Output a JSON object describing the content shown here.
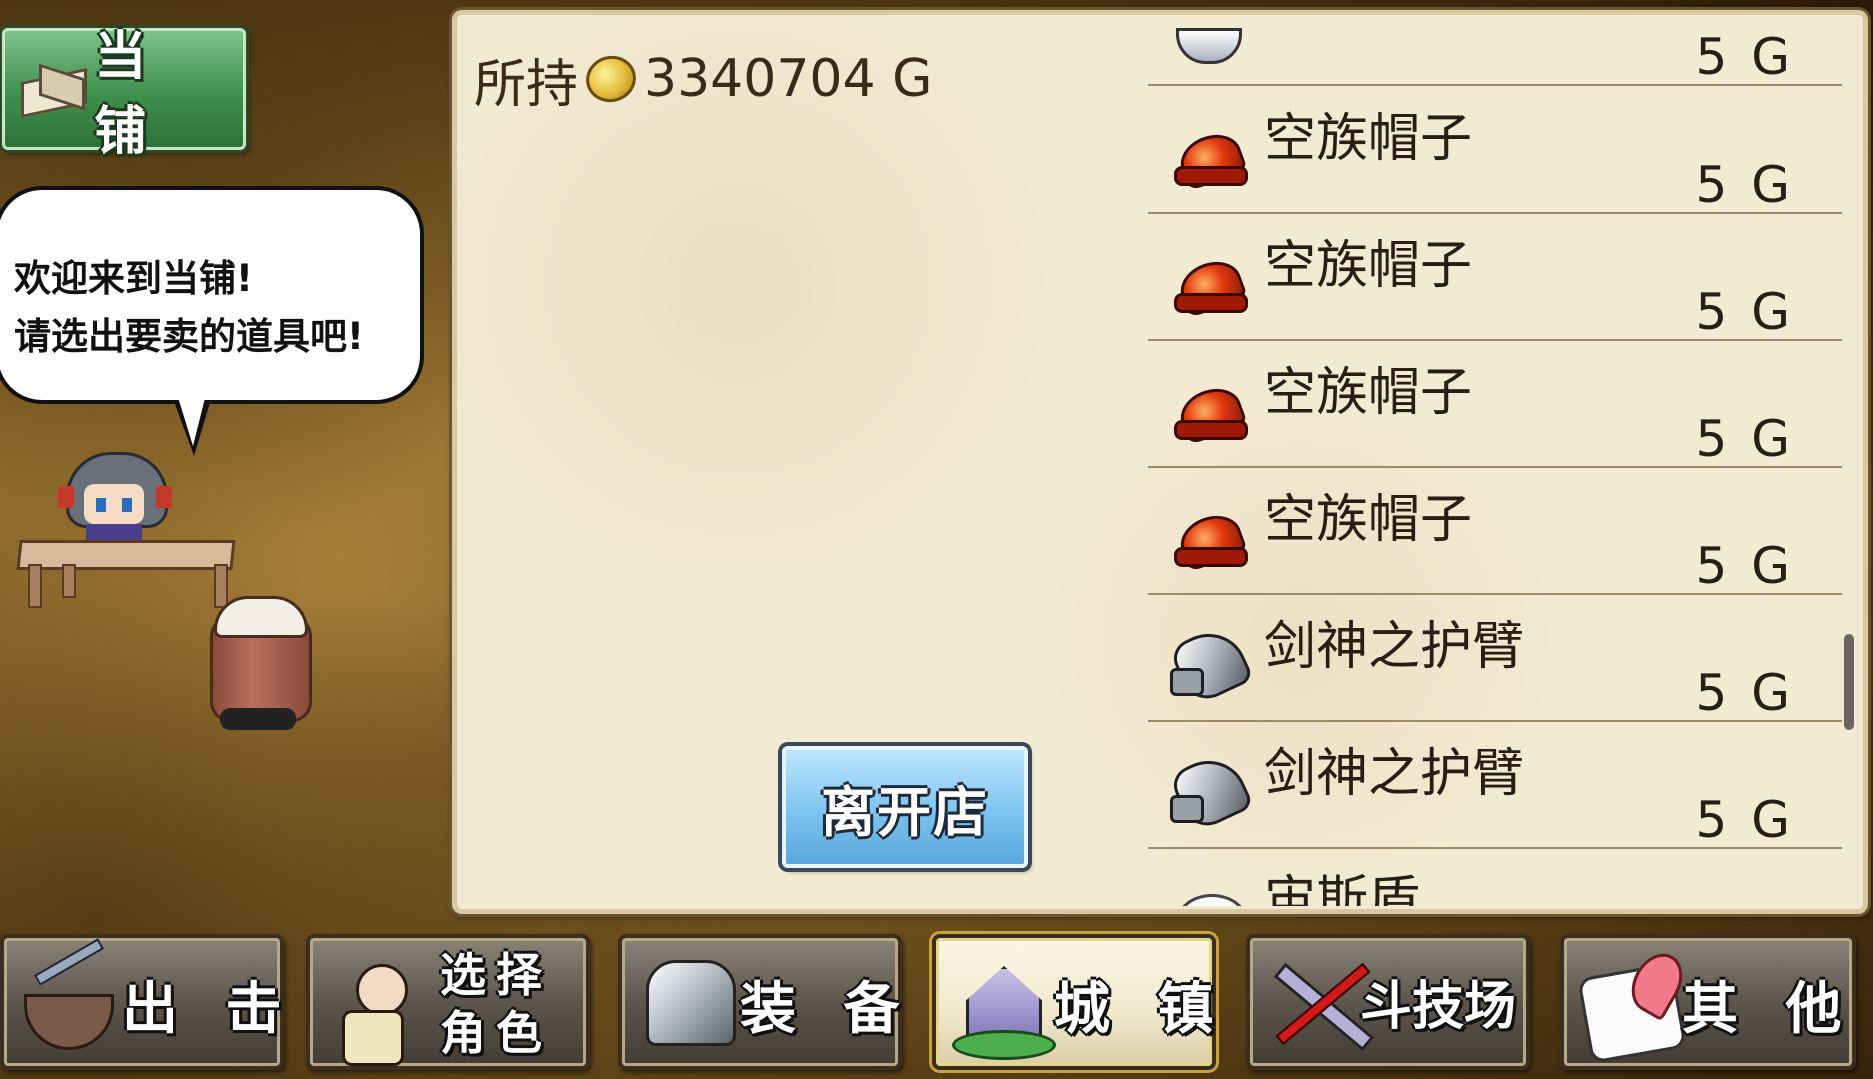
{
  "title": {
    "label": "当 铺",
    "icon": "pawnshop-chest-icon"
  },
  "dialog": {
    "line1": "欢迎来到当铺!",
    "line2": "请选出要卖的道具吧!"
  },
  "money": {
    "prefix": "所持",
    "amount": "3340704 G",
    "icon": "gold-coin-icon"
  },
  "items": [
    {
      "name": "",
      "price": "5 G",
      "icon": "partial-item-icon"
    },
    {
      "name": "空族帽子",
      "price": "5 G",
      "icon": "red-hat-icon"
    },
    {
      "name": "空族帽子",
      "price": "5 G",
      "icon": "red-hat-icon"
    },
    {
      "name": "空族帽子",
      "price": "5 G",
      "icon": "red-hat-icon"
    },
    {
      "name": "空族帽子",
      "price": "5 G",
      "icon": "red-hat-icon"
    },
    {
      "name": "剑神之护臂",
      "price": "5 G",
      "icon": "silver-gauntlet-icon"
    },
    {
      "name": "剑神之护臂",
      "price": "5 G",
      "icon": "silver-gauntlet-icon"
    },
    {
      "name": "宙斯盾",
      "price": "",
      "icon": "shield-icon"
    }
  ],
  "leave_button": "离开店",
  "tabs": [
    {
      "label": "出 击",
      "icon": "sortie-boat-icon",
      "active": false
    },
    {
      "label": "选择\n角色",
      "icon": "character-select-icon",
      "active": false
    },
    {
      "label": "装 备",
      "icon": "equipment-armor-icon",
      "active": false
    },
    {
      "label": "城 镇",
      "icon": "town-castle-icon",
      "active": true
    },
    {
      "label": "斗技场",
      "icon": "arena-swords-icon",
      "active": false
    },
    {
      "label": "其 他",
      "icon": "other-scroll-icon",
      "active": false
    }
  ],
  "colors": {
    "panel_bg": "#f3ead3",
    "title_badge": "#3f8f4c",
    "leave_button": "#7cc3ee",
    "tab_bg": "#5c564d",
    "tab_active_bg": "#efe8cc",
    "text_dark": "#2a1e14"
  }
}
